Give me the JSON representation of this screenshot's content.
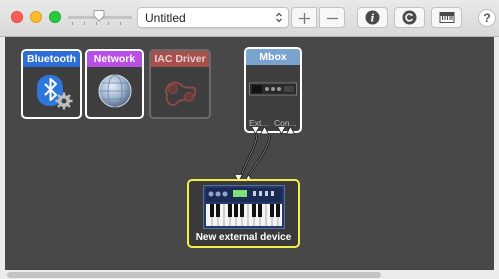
{
  "toolbar": {
    "configuration": "Untitled",
    "add_icon": "plus-icon",
    "remove_icon": "minus-icon",
    "info_icon": "info-icon",
    "test_icon": "test-setup-icon",
    "keyboard_icon": "midi-keyboard-icon",
    "help_label": "?"
  },
  "devices": [
    {
      "name": "Bluetooth",
      "icon": "bluetooth-icon",
      "color": "#2d6ed8"
    },
    {
      "name": "Network",
      "icon": "network-globe-icon",
      "color": "#b94fe6"
    },
    {
      "name": "IAC Driver",
      "icon": "iac-driver-icon",
      "color": "#a7514f"
    },
    {
      "name": "Mbox",
      "icon": "audio-interface-icon",
      "color": "#7aa3cf",
      "ports": [
        "Ext...",
        "Con..."
      ]
    },
    {
      "name": "New external device",
      "icon": "synthesizer-keyboard-icon",
      "highlight": "#f3f04d"
    }
  ],
  "colors": {
    "canvas": "#484848",
    "selection": "#f3f04d"
  }
}
